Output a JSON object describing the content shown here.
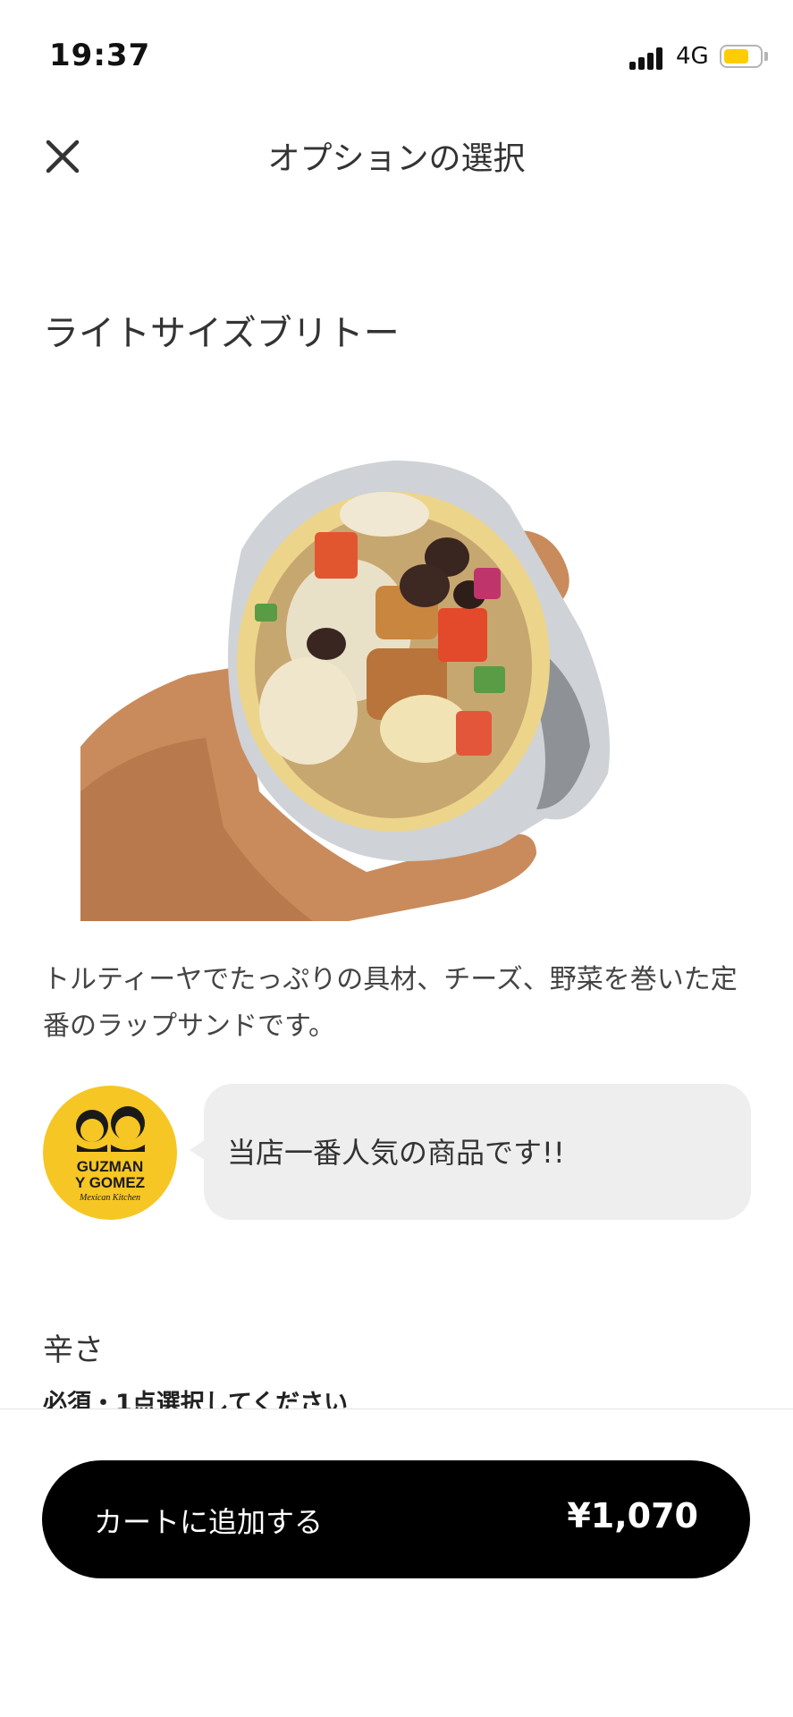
{
  "status_bar": {
    "time": "19:37",
    "network": "4G",
    "battery_level": 0.7,
    "signal_icon": "cellular-signal-icon",
    "battery_icon": "battery-icon",
    "battery_color": "#ffcc00"
  },
  "header": {
    "title": "オプションの選択",
    "close_icon": "close-icon"
  },
  "product": {
    "name": "ライトサイズブリトー",
    "image_icon": "burrito-photo",
    "description": "トルティーヤでたっぷりの具材、チーズ、野菜を巻いた定番のラップサンドです。"
  },
  "store": {
    "logo_line1": "GUZMAN",
    "logo_line2": "Y GOMEZ",
    "logo_line3": "Mexican Kitchen",
    "logo_color": "#f6c624",
    "message": "当店一番人気の商品です!!"
  },
  "option_section": {
    "title": "辛さ",
    "subtitle": "必須・1点選択してください"
  },
  "cart": {
    "label": "カートに追加する",
    "price": "¥1,070",
    "button_color": "#000000"
  }
}
